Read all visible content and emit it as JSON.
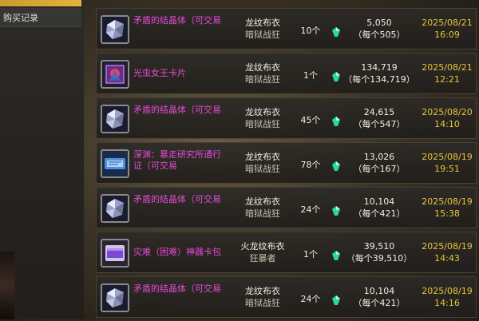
{
  "sidebar": {
    "item_label": "购买记录"
  },
  "colors": {
    "item_name": "#e64ad6",
    "date": "#e6c63a",
    "gem": "#2ad7a6",
    "accent": "#e6b43a"
  },
  "records": [
    {
      "icon": "crystal-icon",
      "name": "矛盾的结晶体（可交易",
      "seller": "龙纹布衣",
      "seller_class": "暗狱战狂",
      "qty": "10个",
      "total": "5,050",
      "unit": "（每个505）",
      "date": "2025/08/21",
      "time": "16:09"
    },
    {
      "icon": "card-icon",
      "name": "光虫女王卡片",
      "seller": "龙纹布衣",
      "seller_class": "暗狱战狂",
      "qty": "1个",
      "total": "134,719",
      "unit": "（每个134,719）",
      "date": "2025/08/21",
      "time": "12:21"
    },
    {
      "icon": "crystal-icon",
      "name": "矛盾的结晶体（可交易",
      "seller": "龙纹布衣",
      "seller_class": "暗狱战狂",
      "qty": "45个",
      "total": "24,615",
      "unit": "（每个547）",
      "date": "2025/08/20",
      "time": "14:10"
    },
    {
      "icon": "ticket-icon",
      "name": "深渊：暴走研究所通行证（可交易",
      "seller": "龙纹布衣",
      "seller_class": "暗狱战狂",
      "qty": "78个",
      "total": "13,026",
      "unit": "（每个167）",
      "date": "2025/08/19",
      "time": "19:51"
    },
    {
      "icon": "crystal-icon",
      "name": "矛盾的结晶体（可交易",
      "seller": "龙纹布衣",
      "seller_class": "暗狱战狂",
      "qty": "24个",
      "total": "10,104",
      "unit": "（每个421）",
      "date": "2025/08/19",
      "time": "15:38"
    },
    {
      "icon": "card-pack-icon",
      "name": "灾难（困难）神器卡包",
      "seller": "火龙纹布衣",
      "seller_class": "狂暴者",
      "qty": "1个",
      "total": "39,510",
      "unit": "（每个39,510）",
      "date": "2025/08/19",
      "time": "14:43"
    },
    {
      "icon": "crystal-icon",
      "name": "矛盾的结晶体（可交易",
      "seller": "龙纹布衣",
      "seller_class": "暗狱战狂",
      "qty": "24个",
      "total": "10,104",
      "unit": "（每个421）",
      "date": "2025/08/19",
      "time": "14:16"
    }
  ]
}
